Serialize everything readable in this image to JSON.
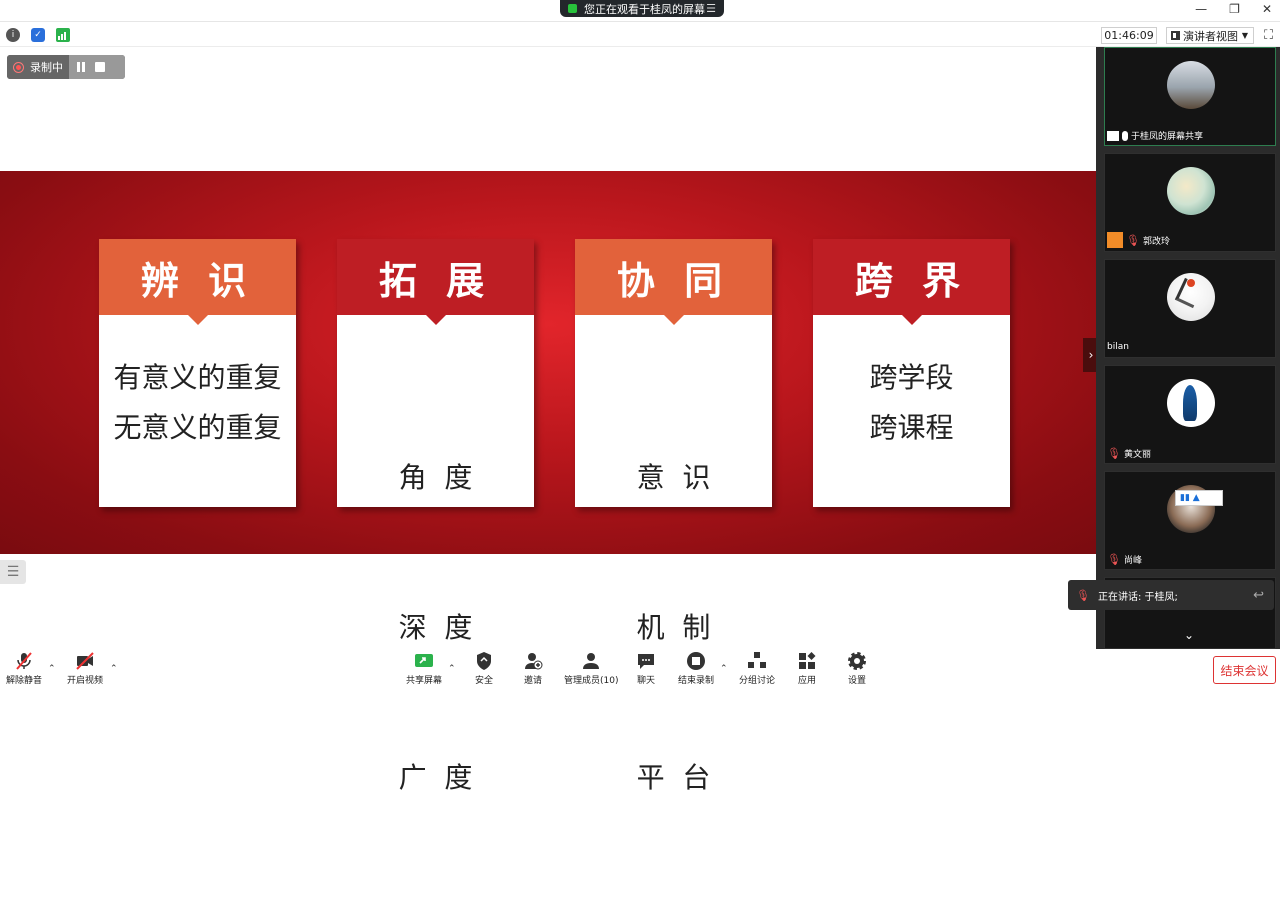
{
  "titlebar": {
    "share_status": "您正在观看于桂凤的屏幕",
    "minimize": "—",
    "restore": "❐",
    "close": "✕"
  },
  "infobar": {
    "timer": "01:46:09",
    "view_mode": "演讲者视图"
  },
  "recording": {
    "label": "录制中"
  },
  "slide": {
    "cards": [
      {
        "title": "辨 识",
        "lines": [
          "有意义的重复",
          "无意义的重复"
        ],
        "color": "#e2623b"
      },
      {
        "title": "拓 展",
        "lines": [
          "角  度",
          "深  度",
          "广  度"
        ],
        "color": "#be1e24"
      },
      {
        "title": "协 同",
        "lines": [
          "意  识",
          "机  制",
          "平  台"
        ],
        "color": "#e2623b"
      },
      {
        "title": "跨 界",
        "lines": [
          "跨学段",
          "跨课程"
        ],
        "color": "#be1e24"
      }
    ]
  },
  "participants": [
    {
      "name": "于桂凤的屏幕共享"
    },
    {
      "name": "郭改玲"
    },
    {
      "name": "bilan"
    },
    {
      "name": "黄文丽"
    },
    {
      "name": "尚峰"
    }
  ],
  "speaking": {
    "text": "正在讲话: 于桂凤;"
  },
  "toolbar": {
    "unmute": "解除静音",
    "start_video": "开启视频",
    "share_screen": "共享屏幕",
    "security": "安全",
    "invite": "邀请",
    "manage": "管理成员(10)",
    "chat": "聊天",
    "end_record": "结束录制",
    "breakout": "分组讨论",
    "apps": "应用",
    "settings": "设置",
    "end_meeting": "结束会议"
  },
  "colors": {
    "accent_green": "#28c23b",
    "slide_red": "#be1e24",
    "slide_orange": "#e2623b",
    "end_red": "#dd3333"
  }
}
